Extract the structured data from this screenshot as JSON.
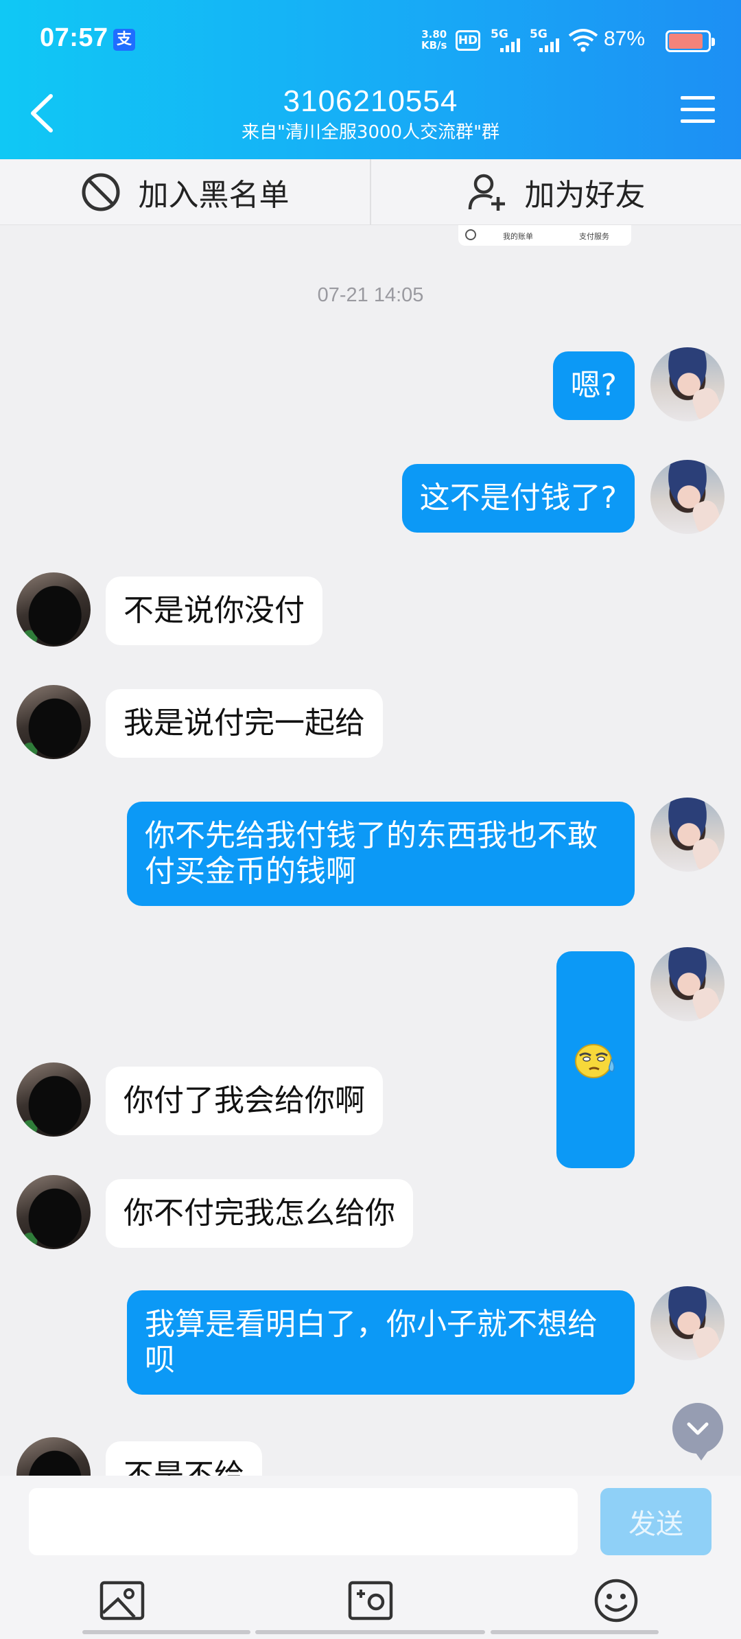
{
  "status": {
    "time": "07:57",
    "app_icon_glyph": "支",
    "net_speed_value": "3.80",
    "net_speed_unit": "KB/s",
    "hd_label": "HD",
    "sim1_label": "5G",
    "sim2_label": "5G",
    "battery_pct": "87%",
    "battery_level": 0.87
  },
  "header": {
    "title": "3106210554",
    "subtitle": "来自\"清川全服3000人交流群\"群"
  },
  "actions": {
    "blacklist_label": "加入黑名单",
    "add_friend_label": "加为好友"
  },
  "remnant": {
    "item1": "我的账单",
    "item2": "支付服务"
  },
  "chat": {
    "timestamp": "07-21 14:05",
    "messages": [
      {
        "from": "self",
        "text": "嗯?"
      },
      {
        "from": "self",
        "text": "这不是付钱了?"
      },
      {
        "from": "other",
        "text": "不是说你没付"
      },
      {
        "from": "other",
        "text": "我是说付完一起给"
      },
      {
        "from": "self",
        "text": "你不先给我付钱了的东西我也不敢\n付买金币的钱啊"
      },
      {
        "from": "self",
        "text": "",
        "emoji": "sweat-emoji"
      },
      {
        "from": "other",
        "text": "你付了我会给你啊"
      },
      {
        "from": "other",
        "text": "你不付完我怎么给你"
      },
      {
        "from": "self",
        "text": "我算是看明白了，你小子就不想给\n呗"
      },
      {
        "from": "other",
        "text": "不是不给"
      }
    ]
  },
  "composer": {
    "input_value": "",
    "send_label": "发送"
  },
  "colors": {
    "header_gradient_start": "#10c8f5",
    "header_gradient_end": "#1d8ff4",
    "self_bubble": "#0c99f6",
    "other_bubble": "#ffffff",
    "send_button_disabled": "#8fd0f7",
    "background": "#f0f0f2"
  },
  "icons": {
    "back": "chevron-left-icon",
    "menu": "hamburger-menu-icon",
    "blacklist": "block-icon",
    "add_friend": "add-user-icon",
    "photo": "photo-icon",
    "camera": "camera-icon",
    "emoji": "smiley-icon",
    "scroll_down": "chevron-down-icon"
  }
}
